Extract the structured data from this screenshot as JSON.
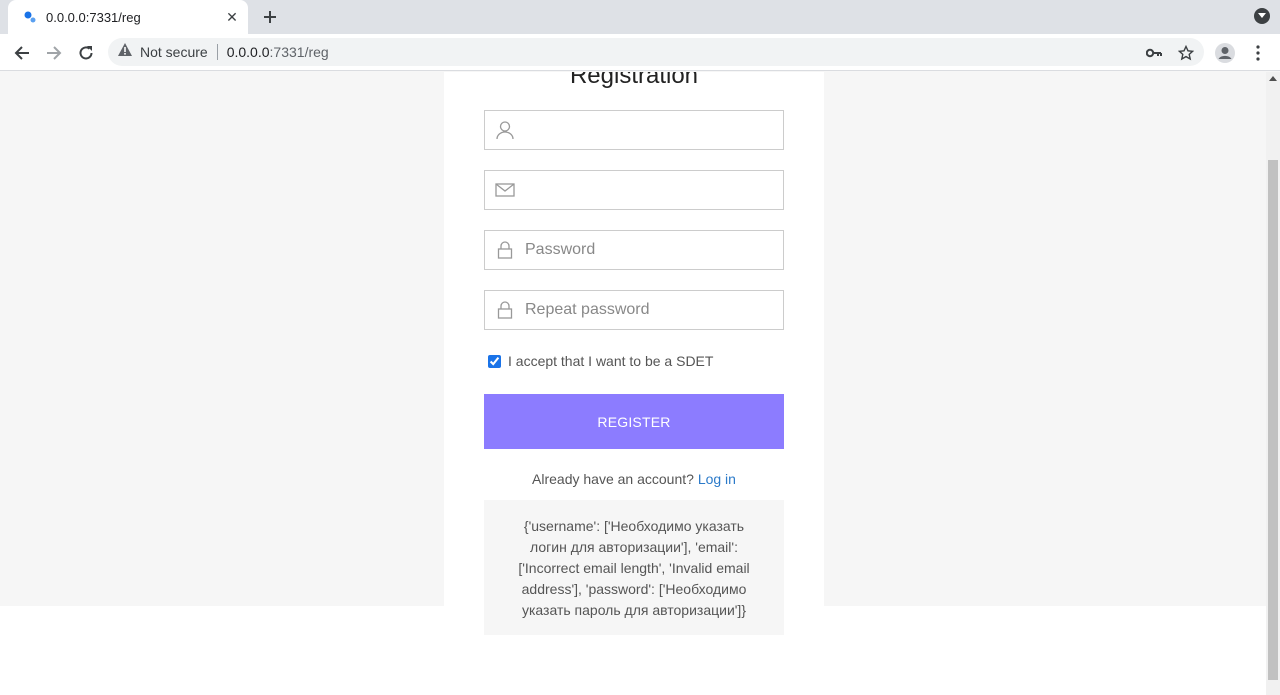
{
  "browser": {
    "tab_title": "0.0.0.0:7331/reg",
    "security_label": "Not secure",
    "url_host": "0.0.0.0",
    "url_path": ":7331/reg"
  },
  "form": {
    "title": "Registration",
    "username": {
      "value": "",
      "placeholder": ""
    },
    "email": {
      "value": "",
      "placeholder": ""
    },
    "password": {
      "value": "",
      "placeholder": "Password"
    },
    "repeat_password": {
      "value": "",
      "placeholder": "Repeat password"
    },
    "accept_label": "I accept that I want to be a SDET",
    "accept_checked": true,
    "register_label": "REGISTER",
    "already_text": "Already have an account?",
    "login_link": "Log in",
    "error_message": "{'username': ['Необходимо указать логин для авторизации'], 'email': ['Incorrect email length', 'Invalid email address'], 'password': ['Необходимо указать пароль для авторизации']}"
  },
  "colors": {
    "register_button": "#8c7cff",
    "link": "#2b7ac9"
  }
}
